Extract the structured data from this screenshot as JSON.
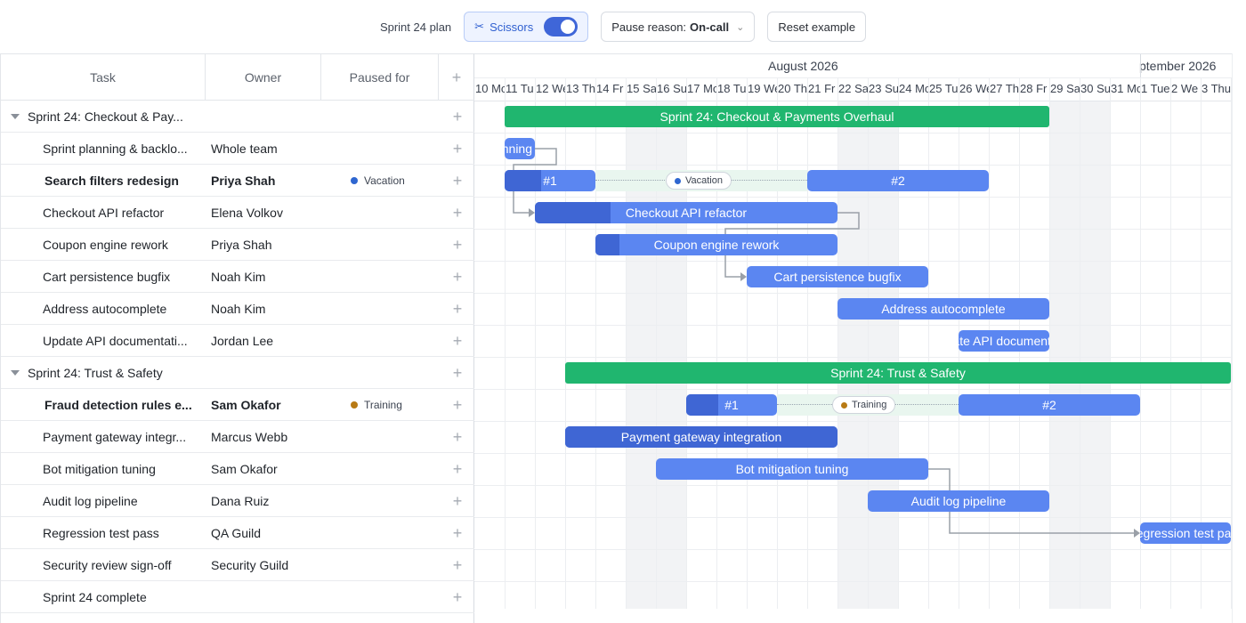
{
  "toolbar": {
    "title": "Sprint 24 plan",
    "scissors_label": "Scissors",
    "scissors_on": true,
    "pause_reason_prefix": "Pause reason:",
    "pause_reason_value": "On-call",
    "reset_label": "Reset example"
  },
  "columns": {
    "task": "Task",
    "owner": "Owner",
    "paused_for": "Paused for"
  },
  "rows": [
    {
      "task": "Sprint 24: Checkout & Pay...",
      "owner": "",
      "paused": "",
      "group": true
    },
    {
      "task": "Sprint planning & backlo...",
      "owner": "Whole team",
      "paused": ""
    },
    {
      "task": "Search filters redesign",
      "owner": "Priya Shah",
      "paused": "Vacation",
      "paused_color": "#2f66d0",
      "bold": true
    },
    {
      "task": "Checkout API refactor",
      "owner": "Elena Volkov",
      "paused": ""
    },
    {
      "task": "Coupon engine rework",
      "owner": "Priya Shah",
      "paused": ""
    },
    {
      "task": "Cart persistence bugfix",
      "owner": "Noah Kim",
      "paused": ""
    },
    {
      "task": "Address autocomplete",
      "owner": "Noah Kim",
      "paused": ""
    },
    {
      "task": "Update API documentati...",
      "owner": "Jordan Lee",
      "paused": ""
    },
    {
      "task": "Sprint 24: Trust & Safety",
      "owner": "",
      "paused": "",
      "group": true
    },
    {
      "task": "Fraud detection rules e...",
      "owner": "Sam Okafor",
      "paused": "Training",
      "paused_color": "#b87a14",
      "bold": true
    },
    {
      "task": "Payment gateway integr...",
      "owner": "Marcus Webb",
      "paused": ""
    },
    {
      "task": "Bot mitigation tuning",
      "owner": "Sam Okafor",
      "paused": ""
    },
    {
      "task": "Audit log pipeline",
      "owner": "Dana Ruiz",
      "paused": ""
    },
    {
      "task": "Regression test pass",
      "owner": "QA Guild",
      "paused": ""
    },
    {
      "task": "Security review sign-off",
      "owner": "Security Guild",
      "paused": ""
    },
    {
      "task": "Sprint 24 complete",
      "owner": "",
      "paused": ""
    }
  ],
  "timeline": {
    "months": [
      "August 2026",
      "ptember 2026"
    ],
    "days": [
      "10 Mo",
      "11 Tu",
      "12 We",
      "13 Th",
      "14 Fr",
      "15 Sa",
      "16 Su",
      "17 Mo",
      "18 Tu",
      "19 We",
      "20 Th",
      "21 Fr",
      "22 Sa",
      "23 Su",
      "24 Mo",
      "25 Tu",
      "26 We",
      "27 Th",
      "28 Fr",
      "29 Sa",
      "30 Su",
      "31 Mo",
      "1 Tue",
      "2 We",
      "3 Thu"
    ]
  },
  "bars": [
    {
      "row": 0,
      "kind": "summary",
      "start": 1,
      "end": 19,
      "label": "Sprint 24: Checkout & Payments Overhaul"
    },
    {
      "row": 1,
      "kind": "task",
      "start": 1,
      "end": 2,
      "label": "Sprint planning & backlog",
      "progress": 0
    },
    {
      "row": 2,
      "kind": "split",
      "segments": [
        {
          "start": 1,
          "end": 4,
          "label": "#1",
          "progress": 0.4
        },
        {
          "start": 11,
          "end": 17,
          "label": "#2",
          "progress": 0
        }
      ],
      "gap_label": "Vacation",
      "gap_color": "#2f66d0"
    },
    {
      "row": 3,
      "kind": "task",
      "start": 2,
      "end": 12,
      "label": "Checkout API refactor",
      "progress": 0.25
    },
    {
      "row": 4,
      "kind": "task",
      "start": 4,
      "end": 12,
      "label": "Coupon engine rework",
      "progress": 0.1
    },
    {
      "row": 5,
      "kind": "task",
      "start": 9,
      "end": 15,
      "label": "Cart persistence bugfix",
      "progress": 0
    },
    {
      "row": 6,
      "kind": "task",
      "start": 12,
      "end": 19,
      "label": "Address autocomplete",
      "progress": 0
    },
    {
      "row": 7,
      "kind": "task",
      "start": 16,
      "end": 19,
      "label": "Update API documentation",
      "progress": 0
    },
    {
      "row": 8,
      "kind": "summary",
      "start": 3,
      "end": 25,
      "label": "Sprint 24: Trust & Safety"
    },
    {
      "row": 9,
      "kind": "split",
      "segments": [
        {
          "start": 7,
          "end": 10,
          "label": "#1",
          "progress": 0.35
        },
        {
          "start": 16,
          "end": 22,
          "label": "#2",
          "progress": 0
        }
      ],
      "gap_label": "Training",
      "gap_color": "#b87a14"
    },
    {
      "row": 10,
      "kind": "task",
      "start": 3,
      "end": 12,
      "label": "Payment gateway integration",
      "progress": 1
    },
    {
      "row": 11,
      "kind": "task",
      "start": 6,
      "end": 15,
      "label": "Bot mitigation tuning",
      "progress": 0
    },
    {
      "row": 12,
      "kind": "task",
      "start": 13,
      "end": 19,
      "label": "Audit log pipeline",
      "progress": 0
    },
    {
      "row": 13,
      "kind": "task",
      "start": 22,
      "end": 25,
      "label": "Regression test pass",
      "progress": 0
    }
  ]
}
